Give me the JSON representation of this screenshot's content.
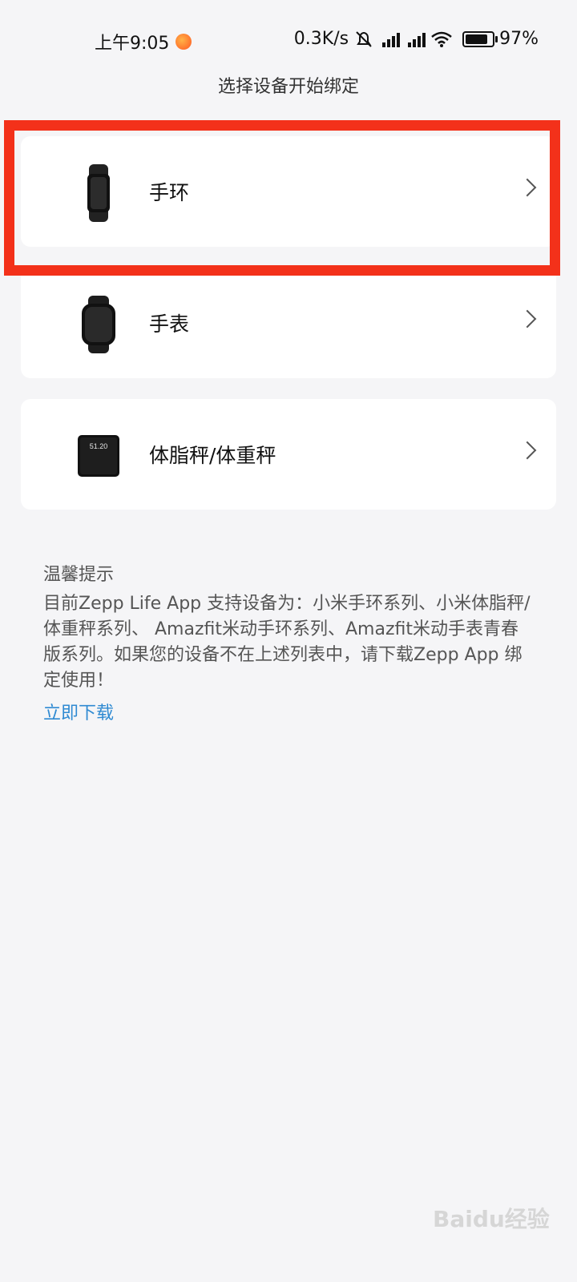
{
  "status_bar": {
    "time": "上午9:05",
    "network_speed": "0.3K/s",
    "battery": "97%",
    "battery_level": 0.97,
    "icons": [
      "notification-dot-icon",
      "mute-icon",
      "signal-hd-icon",
      "signal-hd-icon",
      "wifi-icon",
      "battery-icon"
    ]
  },
  "header": {
    "title": "选择设备开始绑定"
  },
  "devices": [
    {
      "label": "手环",
      "icon": "band-icon"
    },
    {
      "label": "手表",
      "icon": "watch-icon"
    },
    {
      "label": "体脂秤/体重秤",
      "icon": "scale-icon",
      "scale_reading": "51.20"
    }
  ],
  "tips": {
    "title": "温馨提示",
    "body": "目前Zepp Life App 支持设备为：小米手环系列、小米体脂秤/体重秤系列、 Amazfit米动手环系列、Amazfit米动手表青春版系列。如果您的设备不在上述列表中，请下载Zepp App 绑定使用！",
    "download_link": "立即下载"
  },
  "colors": {
    "highlight": "#f3311a",
    "link": "#2f8ad2",
    "background": "#f5f5f7"
  },
  "watermark": "Baidu经验"
}
